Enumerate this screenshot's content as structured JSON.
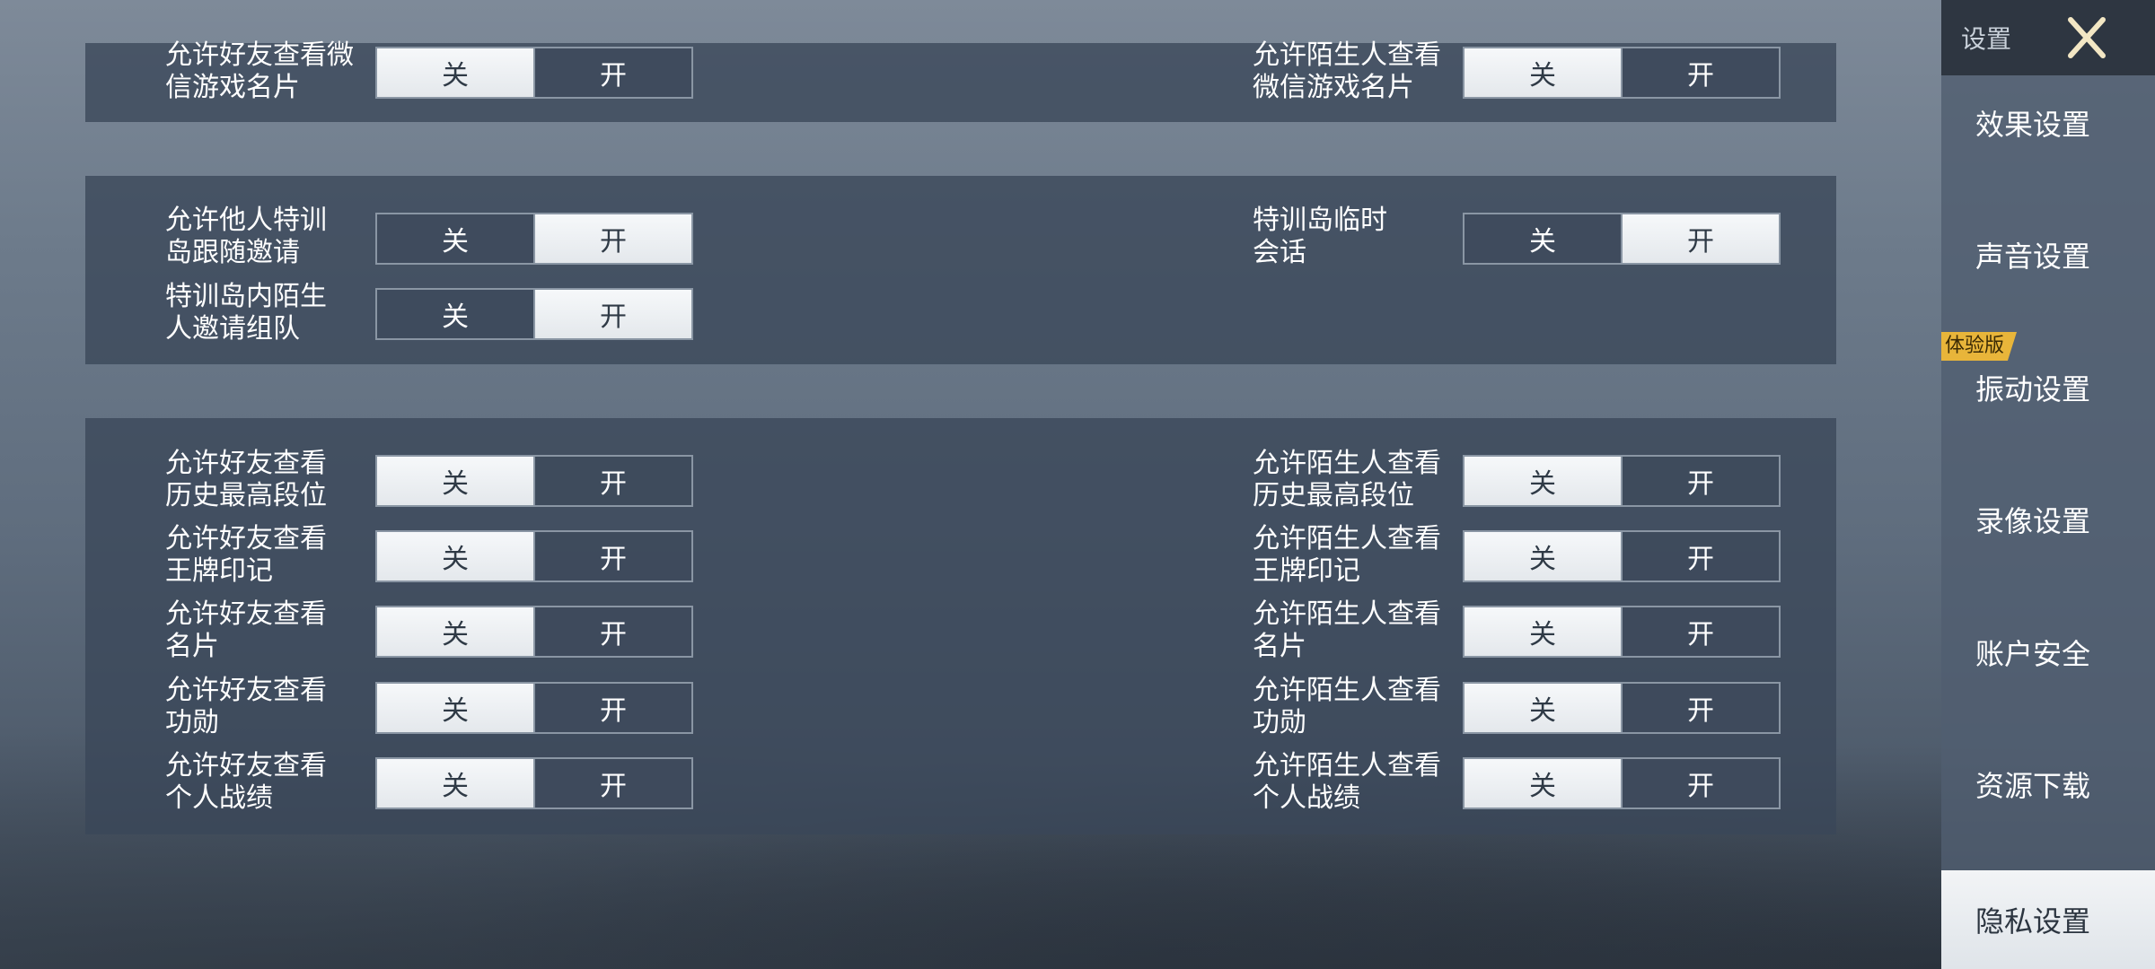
{
  "sidebar": {
    "title": "设置",
    "badge": "体验版",
    "items": [
      {
        "label": "效果设置",
        "active": false
      },
      {
        "label": "声音设置",
        "active": false
      },
      {
        "label": "振动设置",
        "active": false
      },
      {
        "label": "录像设置",
        "active": false
      },
      {
        "label": "账户安全",
        "active": false
      },
      {
        "label": "资源下载",
        "active": false
      },
      {
        "label": "隐私设置",
        "active": true
      }
    ]
  },
  "toggle_labels": {
    "off": "关",
    "on": "开"
  },
  "settings": {
    "s1_left": {
      "line1": "允许好友查看微",
      "line2": "信游戏名片",
      "state": "off"
    },
    "s1_right": {
      "line1": "允许陌生人查看",
      "line2": "微信游戏名片",
      "state": "off"
    },
    "s2_left_a": {
      "line1": "允许他人特训",
      "line2": "岛跟随邀请",
      "state": "on"
    },
    "s2_left_b": {
      "line1": "特训岛内陌生",
      "line2": "人邀请组队",
      "state": "on"
    },
    "s2_right": {
      "line1": "特训岛临时",
      "line2": "会话",
      "state": "on"
    },
    "s3_l1": {
      "line1": "允许好友查看",
      "line2": "历史最高段位",
      "state": "off"
    },
    "s3_l2": {
      "line1": "允许好友查看",
      "line2": "王牌印记",
      "state": "off"
    },
    "s3_l3": {
      "line1": "允许好友查看",
      "line2": "名片",
      "state": "off"
    },
    "s3_l4": {
      "line1": "允许好友查看",
      "line2": "功勋",
      "state": "off"
    },
    "s3_l5": {
      "line1": "允许好友查看",
      "line2": "个人战绩",
      "state": "off"
    },
    "s3_r1": {
      "line1": "允许陌生人查看",
      "line2": "历史最高段位",
      "state": "off"
    },
    "s3_r2": {
      "line1": "允许陌生人查看",
      "line2": "王牌印记",
      "state": "off"
    },
    "s3_r3": {
      "line1": "允许陌生人查看",
      "line2": "名片",
      "state": "off"
    },
    "s3_r4": {
      "line1": "允许陌生人查看",
      "line2": "功勋",
      "state": "off"
    },
    "s3_r5": {
      "line1": "允许陌生人查看",
      "line2": "个人战绩",
      "state": "off"
    }
  }
}
